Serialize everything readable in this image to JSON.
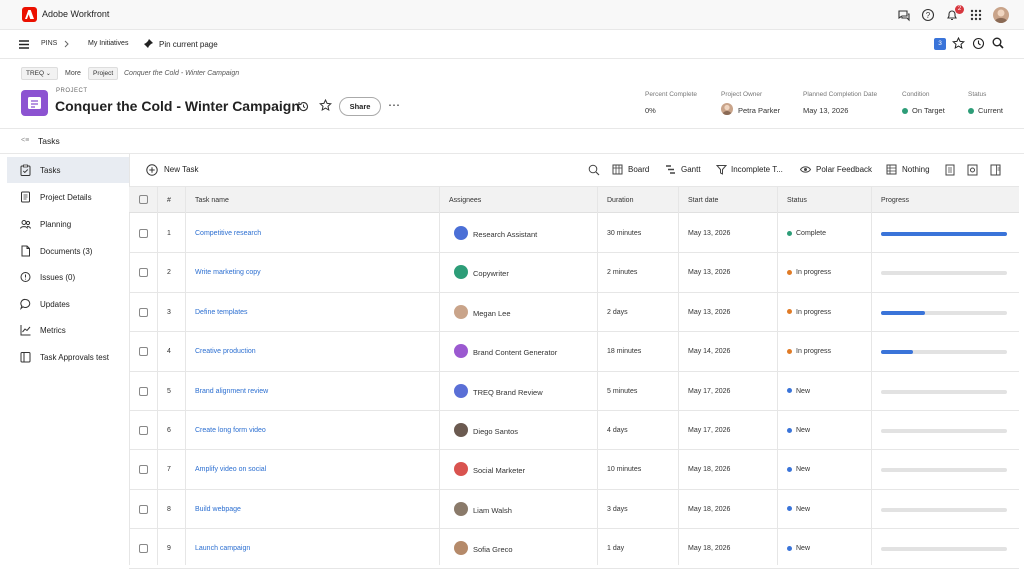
{
  "app": {
    "name": "Adobe Workfront",
    "notifications_count": "2"
  },
  "pins": {
    "label": "PINS",
    "initiatives": "My Initiatives",
    "pin_current": "Pin current page",
    "count": "3"
  },
  "breadcrumb": {
    "team": "TREQ",
    "more": "More",
    "project_chip": "Project",
    "current": "Conquer the Cold - Winter Campaign"
  },
  "project": {
    "type_label": "PROJECT",
    "title": "Conquer the Cold - Winter Campaign",
    "share": "Share"
  },
  "kpis": {
    "percent_label": "Percent Complete",
    "percent_value": "0%",
    "owner_label": "Project Owner",
    "owner_value": "Petra Parker",
    "planned_label": "Planned Completion Date",
    "planned_value": "May 13, 2026",
    "condition_label": "Condition",
    "condition_value": "On Target",
    "status_label": "Status",
    "status_value": "Current"
  },
  "section_title": "Tasks",
  "sidebar": {
    "items": [
      {
        "label": "Tasks",
        "icon": "clipboard-icon"
      },
      {
        "label": "Project Details",
        "icon": "document-icon"
      },
      {
        "label": "Planning",
        "icon": "people-icon"
      },
      {
        "label": "Documents (3)",
        "icon": "file-icon"
      },
      {
        "label": "Issues (0)",
        "icon": "alert-icon"
      },
      {
        "label": "Updates",
        "icon": "chat-icon"
      },
      {
        "label": "Metrics",
        "icon": "chart-icon"
      },
      {
        "label": "Task Approvals test",
        "icon": "approval-icon"
      }
    ]
  },
  "toolbar": {
    "new_task": "New Task",
    "board": "Board",
    "gantt": "Gantt",
    "filter": "Incomplete T...",
    "view": "Polar Feedback",
    "grouping": "Nothing"
  },
  "table": {
    "headers": {
      "num": "#",
      "name": "Task name",
      "assignees": "Assignees",
      "duration": "Duration",
      "start": "Start date",
      "status": "Status",
      "progress": "Progress"
    },
    "rows": [
      {
        "num": "1",
        "name": "Competitive research",
        "assignee": "Research Assistant",
        "duration": "30 minutes",
        "start": "May 13, 2026",
        "status": "Complete",
        "progress": 1.0
      },
      {
        "num": "2",
        "name": "Write marketing copy",
        "assignee": "Copywriter",
        "duration": "2 minutes",
        "start": "May 13, 2026",
        "status": "In progress",
        "progress": 0
      },
      {
        "num": "3",
        "name": "Define templates",
        "assignee": "Megan Lee",
        "duration": "2 days",
        "start": "May 13, 2026",
        "status": "In progress",
        "progress": 0.35
      },
      {
        "num": "4",
        "name": "Creative production",
        "assignee": "Brand Content Generator",
        "duration": "18 minutes",
        "start": "May 14, 2026",
        "status": "In progress",
        "progress": 0.25
      },
      {
        "num": "5",
        "name": "Brand alignment review",
        "assignee": "TREQ Brand Review",
        "duration": "5 minutes",
        "start": "May 17, 2026",
        "status": "New",
        "progress": 0
      },
      {
        "num": "6",
        "name": "Create long form video",
        "assignee": "Diego Santos",
        "duration": "4 days",
        "start": "May 17, 2026",
        "status": "New",
        "progress": 0
      },
      {
        "num": "7",
        "name": "Amplify video on social",
        "assignee": "Social Marketer",
        "duration": "10 minutes",
        "start": "May 18, 2026",
        "status": "New",
        "progress": 0
      },
      {
        "num": "8",
        "name": "Build webpage",
        "assignee": "Liam Walsh",
        "duration": "3 days",
        "start": "May 18, 2026",
        "status": "New",
        "progress": 0
      },
      {
        "num": "9",
        "name": "Launch campaign",
        "assignee": "Sofia Greco",
        "duration": "1 day",
        "start": "May 18, 2026",
        "status": "New",
        "progress": 0
      }
    ]
  },
  "colors": {
    "accent": "#3a74d9",
    "brand": "#eb1000",
    "complete": "#2d9d78",
    "in_progress": "#e07b26",
    "new": "#3a74d9",
    "project_icon": "#8c53d1"
  }
}
